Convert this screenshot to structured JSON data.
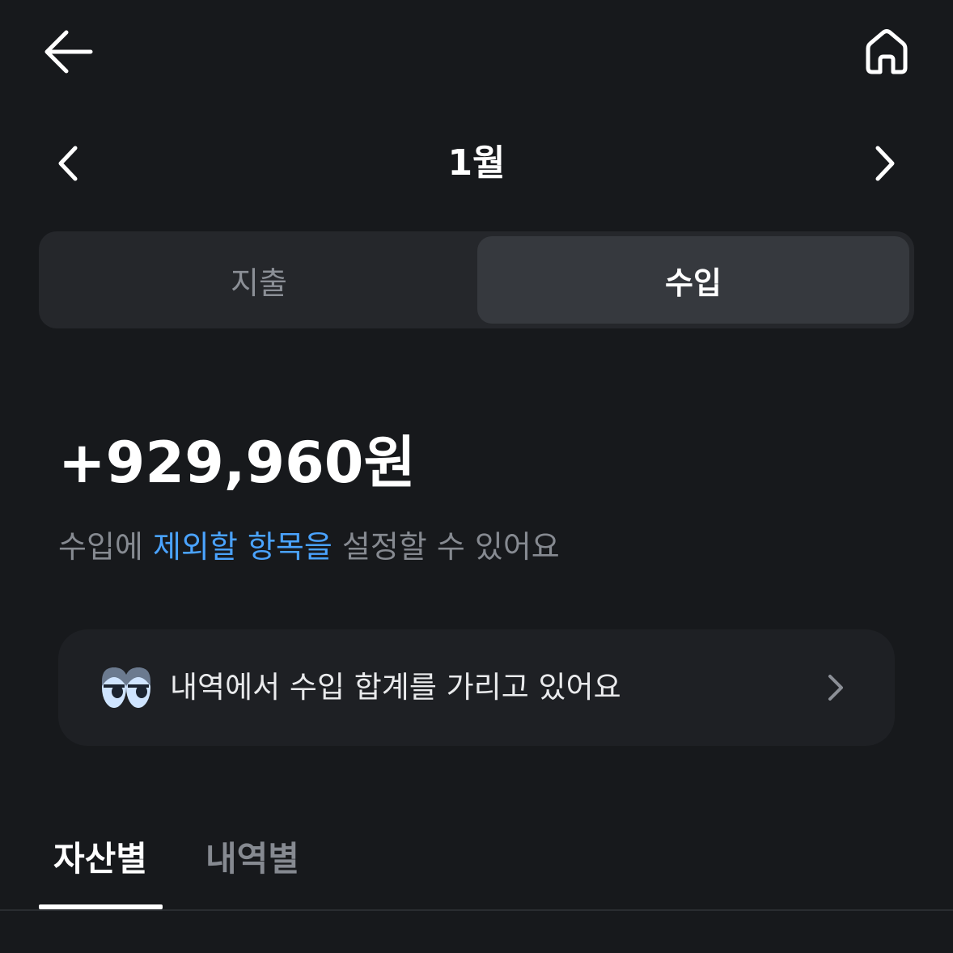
{
  "header": {
    "back_icon": "arrow-left-icon",
    "home_icon": "home-icon"
  },
  "month_nav": {
    "title": "1월",
    "prev_icon": "chevron-left-icon",
    "next_icon": "chevron-right-icon"
  },
  "segment": {
    "tabs": [
      {
        "label": "지출",
        "selected": false
      },
      {
        "label": "수입",
        "selected": true
      }
    ]
  },
  "summary": {
    "amount": "+929,960원",
    "hint_prefix": "수입에 ",
    "hint_link": "제외할 항목을",
    "hint_suffix": " 설정할 수 있어요"
  },
  "notice": {
    "icon": "eyes-icon",
    "text": "내역에서 수입 합계를 가리고 있어요",
    "chevron_icon": "chevron-right-icon"
  },
  "bottom_tabs": [
    {
      "label": "자산별",
      "selected": true
    },
    {
      "label": "내역별",
      "selected": false
    }
  ],
  "colors": {
    "background": "#17191c",
    "link": "#4aa3ff",
    "segment_bg": "#25272b",
    "segment_selected": "#36393e",
    "card_bg": "#1e2024"
  }
}
